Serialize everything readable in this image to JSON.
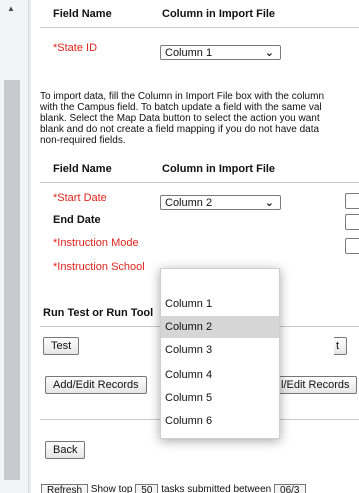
{
  "mapping_top": {
    "header_field": "Field Name",
    "header_column": "Column in Import File",
    "state_id_label": "*State ID",
    "state_id_value": "Column 1"
  },
  "instructions": [
    "To import data, fill the Column in Import File box with the column",
    "with the Campus field. To batch update a field with the same val",
    "blank. Select the Map Data button to select the action you want",
    "blank and do not create a field mapping if you do not have data",
    "non-required fields."
  ],
  "mapping_main": {
    "header_field": "Field Name",
    "header_column": "Column in Import File",
    "rows": [
      {
        "label": "*Start Date",
        "required": true,
        "value": "Column 2"
      },
      {
        "label": "End Date",
        "required": false,
        "value": ""
      },
      {
        "label": "*Instruction Mode",
        "required": true,
        "value": ""
      },
      {
        "label": "*Instruction School",
        "required": true,
        "value": ""
      }
    ]
  },
  "dropdown": {
    "options": [
      "",
      "Column 1",
      "Column 2",
      "Column 3",
      "Column 4",
      "Column 5",
      "Column 6"
    ],
    "selected": "Column 2"
  },
  "run_section": {
    "title": "Run Test or Run Tool",
    "test_button": "Test",
    "run_button_partial": "t",
    "add_edit_button": "Add/Edit Records",
    "add_edit_button_partial": "l/Edit Records"
  },
  "back_button": "Back",
  "bottom_bar": {
    "refresh_partial": "Refresh",
    "show_label": "Show top",
    "count_value": "50",
    "tail_text": "tasks submitted between",
    "date_partial": "06/3"
  },
  "icons": {
    "dropdown_chevron": "chevron-down-icon",
    "scroll_up": "scroll-up-arrow-icon"
  }
}
